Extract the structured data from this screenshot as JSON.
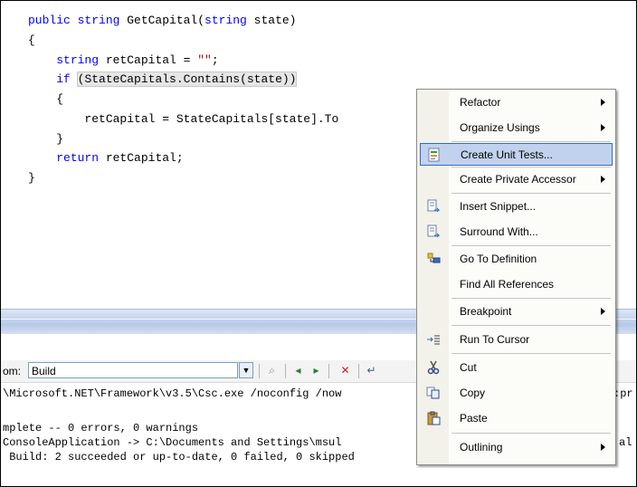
{
  "code": {
    "lines": [
      {
        "indent": "",
        "kw": "public string",
        "text": " GetCapital(",
        "kw2": "string",
        "text2": " state)"
      },
      {
        "indent": "",
        "text": "{"
      },
      {
        "indent": "    ",
        "kw": "string",
        "text": " retCapital = ",
        "str": "\"\"",
        "text2": ";"
      },
      {
        "indent": "    ",
        "kw": "if",
        "text": " ",
        "hl": "(StateCapitals.Contains(state))"
      },
      {
        "indent": "    ",
        "text": "{"
      },
      {
        "indent": "        ",
        "text": "retCapital = StateCapitals[state].To"
      },
      {
        "indent": "    ",
        "text": "}"
      },
      {
        "indent": "    ",
        "kw": "return",
        "text": " retCapital;"
      },
      {
        "indent": "",
        "text": "}"
      }
    ]
  },
  "output": {
    "show_label": "om:",
    "show_value": "Build",
    "lines": [
      "\\Microsoft.NET\\Framework\\v3.5\\Csc.exe /noconfig /now",
      "",
      "mplete -- 0 errors, 0 warnings",
      "ConsoleApplication -> C:\\Documents and Settings\\msul",
      " Build: 2 succeeded or up-to-date, 0 failed, 0 skipped"
    ],
    "right_fragments": [
      ":pr",
      "al"
    ]
  },
  "context_menu": {
    "items": [
      {
        "label": "Refactor",
        "submenu": true,
        "icon": ""
      },
      {
        "label": "Organize Usings",
        "submenu": true,
        "icon": ""
      },
      {
        "label": "Create Unit Tests...",
        "submenu": false,
        "icon": "unit-test-icon",
        "selected": true
      },
      {
        "label": "Create Private Accessor",
        "submenu": true,
        "icon": ""
      },
      {
        "label": "Insert Snippet...",
        "submenu": false,
        "icon": "snippet-icon"
      },
      {
        "label": "Surround With...",
        "submenu": false,
        "icon": "surround-icon"
      },
      {
        "label": "Go To Definition",
        "submenu": false,
        "icon": "goto-definition-icon"
      },
      {
        "label": "Find All References",
        "submenu": false,
        "icon": ""
      },
      {
        "label": "Breakpoint",
        "submenu": true,
        "icon": ""
      },
      {
        "label": "Run To Cursor",
        "submenu": false,
        "icon": "run-to-cursor-icon"
      },
      {
        "label": "Cut",
        "submenu": false,
        "icon": "cut-icon"
      },
      {
        "label": "Copy",
        "submenu": false,
        "icon": "copy-icon"
      },
      {
        "label": "Paste",
        "submenu": false,
        "icon": "paste-icon"
      },
      {
        "label": "Outlining",
        "submenu": true,
        "icon": ""
      }
    ]
  },
  "colors": {
    "keyword": "#0000ff",
    "string": "#a31515",
    "menu_highlight": "#c1d2ee",
    "menu_highlight_border": "#316ac5"
  }
}
